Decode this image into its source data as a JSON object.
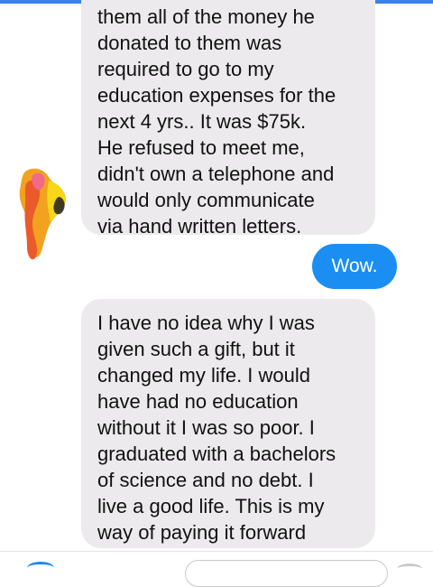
{
  "conversation": {
    "messages": [
      {
        "sender": "contact",
        "text": "them all of the money he\ndonated to them was\nrequired to go to my\neducation expenses for the\nnext 4 yrs..  It was $75k.\nHe refused to meet me,\ndidn't own a telephone and\nwould only communicate\nvia hand written letters."
      },
      {
        "sender": "me",
        "text": "Wow."
      },
      {
        "sender": "contact",
        "text": "I have no idea why I was\ngiven such a gift, but it\nchanged my life.  I would\nhave had no education\nwithout it I was so poor.  I\ngraduated with a bachelors\nof science and no debt.  I\nlive a good life.  This is my\nway of paying it forward"
      }
    ]
  },
  "colors": {
    "accent": "#1a8ef2",
    "incoming_bubble": "#eceaec",
    "top_bar": "#3b82e6"
  },
  "icons": {
    "avatar": "redacted-avatar-icon",
    "composer_left": "composer-action-icon",
    "composer_right": "composer-action-icon"
  }
}
